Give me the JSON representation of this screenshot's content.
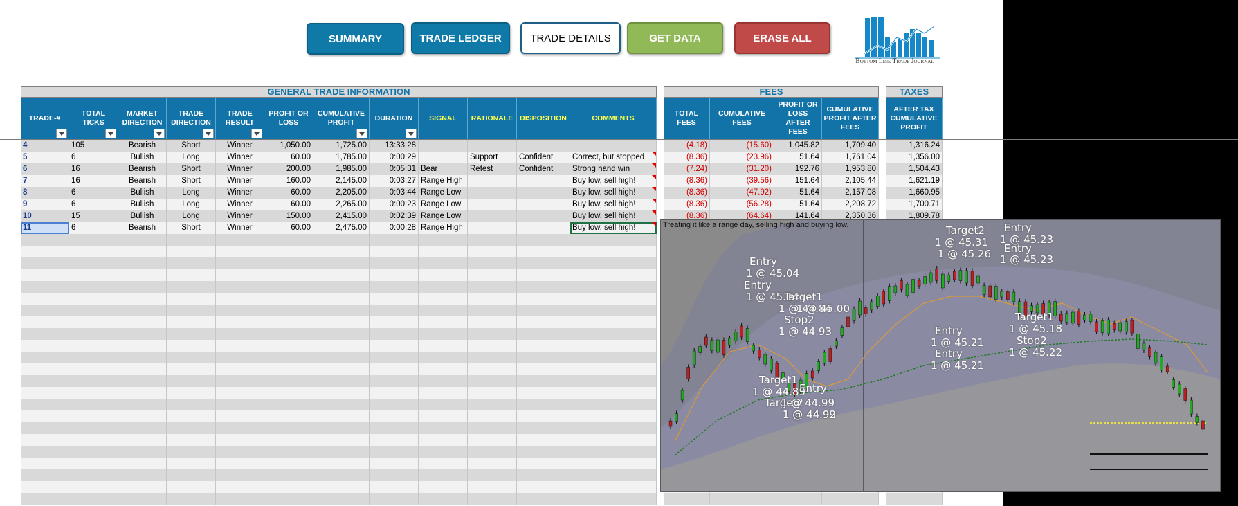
{
  "buttons": {
    "summary": "SUMMARY",
    "trade_ledger": "TRADE LEDGER",
    "trade_details": "TRADE DETAILS",
    "get_data": "GET DATA",
    "erase_all": "ERASE ALL"
  },
  "logo": {
    "text": "Bottom Line Trade Journal"
  },
  "sections": {
    "general": "GENERAL TRADE INFORMATION",
    "fees": "FEES",
    "taxes": "TAXES"
  },
  "columns": {
    "general": [
      "TRADE-#",
      "TOTAL TICKS",
      "MARKET DIRECTION",
      "TRADE DIRECTION",
      "TRADE RESULT",
      "PROFIT OR LOSS",
      "CUMULATIVE PROFIT",
      "DURATION",
      "SIGNAL",
      "RATIONALE",
      "DISPOSITION",
      "COMMENTS"
    ],
    "fees": [
      "TOTAL FEES",
      "CUMULATIVE FEES",
      "PROFIT OR LOSS AFTER FEES",
      "CUMULATIVE PROFIT AFTER FEES"
    ],
    "taxes": [
      "AFTER TAX CUMULATIVE PROFIT"
    ]
  },
  "rows": [
    {
      "trade": "4",
      "ticks": "105",
      "market": "Bearish",
      "direction": "Short",
      "result": "Winner",
      "pl": "1,050.00",
      "cum": "1,725.00",
      "duration": "13:33:28",
      "signal": "",
      "rationale": "",
      "disposition": "",
      "comments": "",
      "fees": "(4.18)",
      "cum_fees": "(15.60)",
      "pl_after": "1,045.82",
      "cum_after": "1,709.40",
      "tax": "1,316.24"
    },
    {
      "trade": "5",
      "ticks": "6",
      "market": "Bullish",
      "direction": "Long",
      "result": "Winner",
      "pl": "60.00",
      "cum": "1,785.00",
      "duration": "0:00:29",
      "signal": "",
      "rationale": "Support",
      "disposition": "Confident",
      "comments": "Correct, but stopped",
      "fees": "(8.36)",
      "cum_fees": "(23.96)",
      "pl_after": "51.64",
      "cum_after": "1,761.04",
      "tax": "1,356.00"
    },
    {
      "trade": "6",
      "ticks": "16",
      "market": "Bearish",
      "direction": "Short",
      "result": "Winner",
      "pl": "200.00",
      "cum": "1,985.00",
      "duration": "0:05:31",
      "signal": "Bear",
      "rationale": "Retest",
      "disposition": "Confident",
      "comments": "Strong hand win",
      "fees": "(7.24)",
      "cum_fees": "(31.20)",
      "pl_after": "192.76",
      "cum_after": "1,953.80",
      "tax": "1,504.43"
    },
    {
      "trade": "7",
      "ticks": "16",
      "market": "Bearish",
      "direction": "Short",
      "result": "Winner",
      "pl": "160.00",
      "cum": "2,145.00",
      "duration": "0:03:27",
      "signal": "Range High",
      "rationale": "",
      "disposition": "",
      "comments": "Buy low, sell high!",
      "fees": "(8.36)",
      "cum_fees": "(39.56)",
      "pl_after": "151.64",
      "cum_after": "2,105.44",
      "tax": "1,621.19"
    },
    {
      "trade": "8",
      "ticks": "6",
      "market": "Bullish",
      "direction": "Long",
      "result": "Winner",
      "pl": "60.00",
      "cum": "2,205.00",
      "duration": "0:03:44",
      "signal": "Range Low",
      "rationale": "",
      "disposition": "",
      "comments": "Buy low, sell high!",
      "fees": "(8.36)",
      "cum_fees": "(47.92)",
      "pl_after": "51.64",
      "cum_after": "2,157.08",
      "tax": "1,660.95"
    },
    {
      "trade": "9",
      "ticks": "6",
      "market": "Bullish",
      "direction": "Long",
      "result": "Winner",
      "pl": "60.00",
      "cum": "2,265.00",
      "duration": "0:00:23",
      "signal": "Range Low",
      "rationale": "",
      "disposition": "",
      "comments": "Buy low, sell high!",
      "fees": "(8.36)",
      "cum_fees": "(56.28)",
      "pl_after": "51.64",
      "cum_after": "2,208.72",
      "tax": "1,700.71"
    },
    {
      "trade": "10",
      "ticks": "15",
      "market": "Bullish",
      "direction": "Long",
      "result": "Winner",
      "pl": "150.00",
      "cum": "2,415.00",
      "duration": "0:02:39",
      "signal": "Range Low",
      "rationale": "",
      "disposition": "",
      "comments": "Buy low, sell high!",
      "fees": "(8.36)",
      "cum_fees": "(64.64)",
      "pl_after": "141.64",
      "cum_after": "2,350.36",
      "tax": "1,809.78"
    },
    {
      "trade": "11",
      "ticks": "6",
      "market": "Bearish",
      "direction": "Short",
      "result": "Winner",
      "pl": "60.00",
      "cum": "2,475.00",
      "duration": "0:00:28",
      "signal": "Range High",
      "rationale": "",
      "disposition": "",
      "comments": "Buy low, sell high!",
      "fees": "",
      "cum_fees": "",
      "pl_after": "",
      "cum_after": "",
      "tax": ""
    }
  ],
  "chart": {
    "caption": "Treating it like a range day, selling high and buying low.",
    "labels": [
      "Entry",
      "1 @ 45.04",
      "Entry",
      "1 @ 45.14",
      "Target1",
      "1 @ 44.84",
      "Stop2",
      "1 @ 45.00",
      "1 @ 44.93",
      "Target1",
      "1 @ 44.89",
      "Target2",
      "1 @ 44.99",
      "Entry",
      "1 @ 44.99",
      "1 @ 44.92",
      "Target2",
      "1 @ 45.31",
      "1 @ 45.26",
      "Entry",
      "1 @ 45.23",
      "Entry",
      "1 @ 45.23",
      "Entry",
      "1 @ 45.21",
      "Entry",
      "1 @ 45.21",
      "Target1",
      "1 @ 45.18",
      "Stop2",
      "1 @ 45.22"
    ]
  },
  "colors": {
    "header_blue": "#1173a8",
    "button_blue": "#0f7aa8",
    "button_green": "#92b957",
    "button_red": "#c04a48",
    "accent_yellow": "#ffff4d",
    "fee_red": "#d40000"
  }
}
